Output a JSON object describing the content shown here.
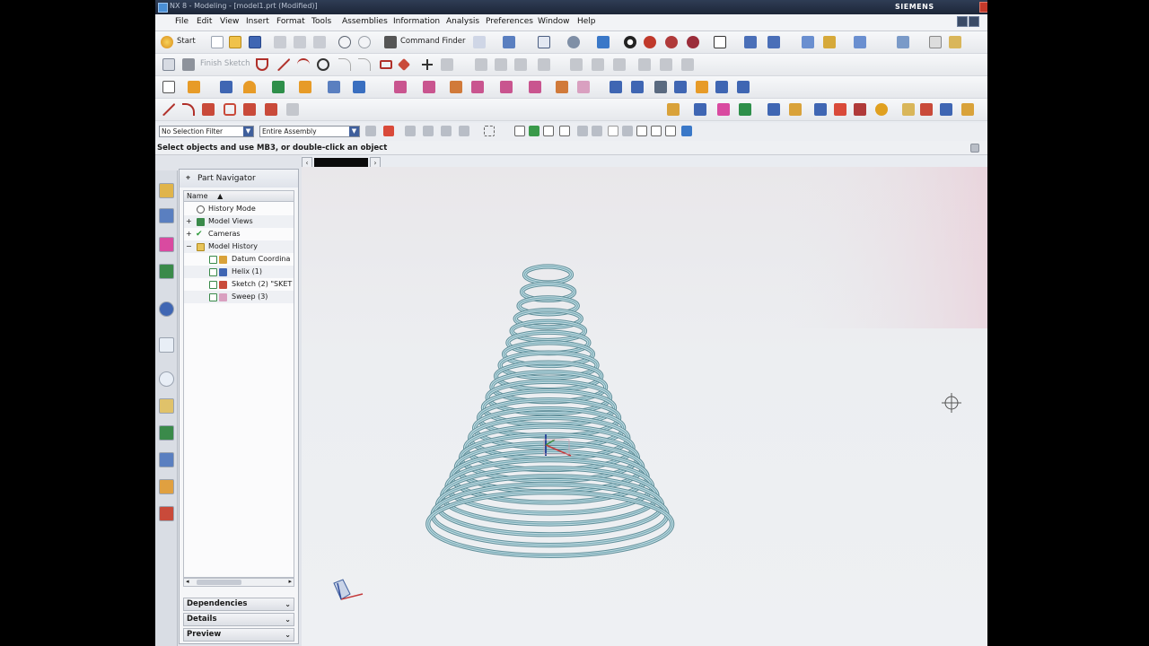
{
  "window": {
    "title": "NX 8 - Modeling - [model1.prt (Modified)]",
    "brand": "SIEMENS"
  },
  "menu": [
    "File",
    "Edit",
    "View",
    "Insert",
    "Format",
    "Tools",
    "Assemblies",
    "Information",
    "Analysis",
    "Preferences",
    "Window",
    "Help"
  ],
  "toolbar": {
    "start_label": "Start",
    "command_finder_label": "Command Finder",
    "finish_sketch_label": "Finish Sketch"
  },
  "selection": {
    "filter_value": "No Selection Filter",
    "scope_value": "Entire Assembly"
  },
  "status_message": "Select objects and use MB3, or double-click an object",
  "part_navigator": {
    "title": "Part Navigator",
    "column_name": "Name",
    "items": [
      {
        "label": "History Mode",
        "icon": "clock-icon"
      },
      {
        "label": "Model Views",
        "icon": "views-icon"
      },
      {
        "label": "Cameras",
        "icon": "camera-icon"
      },
      {
        "label": "Model History",
        "icon": "folder-icon"
      },
      {
        "label": "Datum Coordina",
        "icon": "datum-csys-icon"
      },
      {
        "label": "Helix (1)",
        "icon": "helix-icon"
      },
      {
        "label": "Sketch (2) \"SKET",
        "icon": "sketch-icon"
      },
      {
        "label": "Sweep (3)",
        "icon": "sweep-icon"
      }
    ],
    "docks": [
      "Dependencies",
      "Details",
      "Preview"
    ]
  },
  "colors": {
    "titlebar": "#1d2638",
    "accent": "#3f5f9c",
    "spring_stroke": "#78aab6",
    "viewport_bg": "#eceef1"
  }
}
